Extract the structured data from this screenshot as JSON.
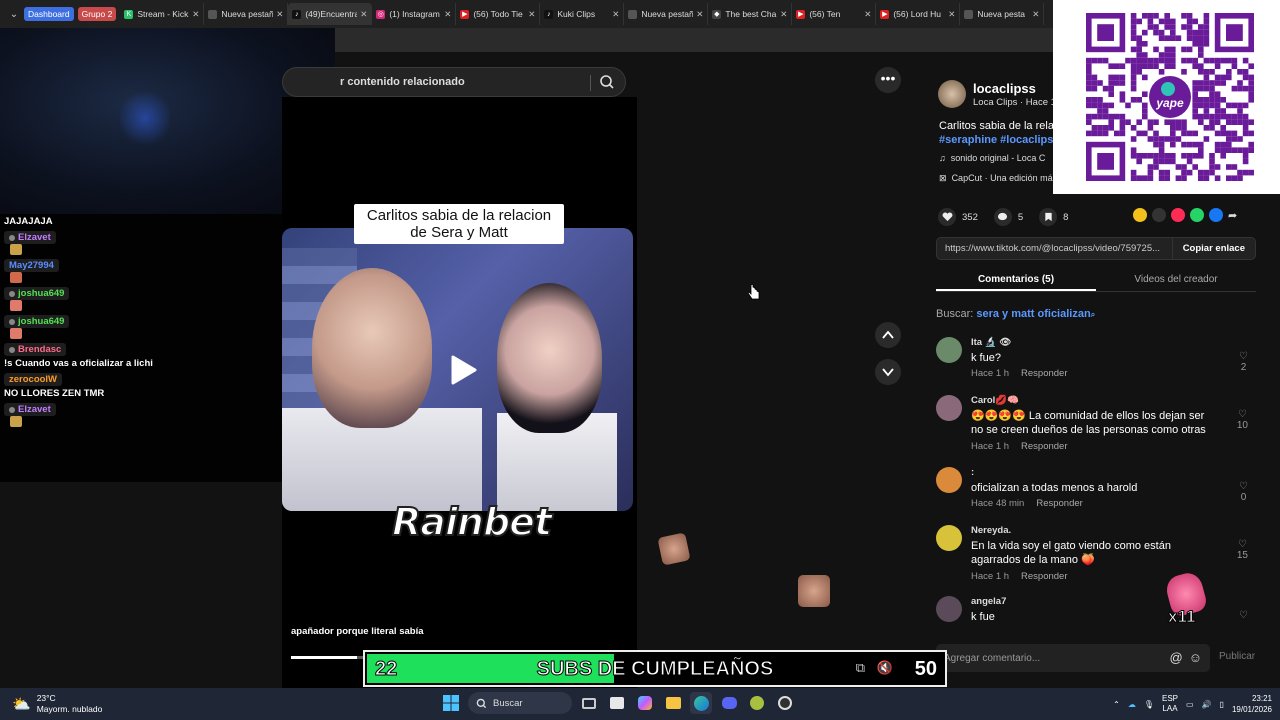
{
  "browser": {
    "groups": [
      {
        "label": "Dashboard",
        "color": "#3d6fe0"
      },
      {
        "label": "Grupo 2",
        "color": "#c84a4a"
      }
    ],
    "tabs": [
      {
        "label": "Stream - Kick",
        "icon_color": "#29c36a",
        "icon": "kick-icon"
      },
      {
        "label": "Nueva pestaña",
        "icon_color": "#555555",
        "icon": "blank-page-icon"
      },
      {
        "label": "(49)Encuentra",
        "icon_color": "#111111",
        "icon": "tiktok-icon",
        "active": true
      },
      {
        "label": "(1) Instagram",
        "icon_color": "#d6287a",
        "icon": "instagram-icon"
      },
      {
        "label": "(56) Todo Tie",
        "icon_color": "#e02020",
        "icon": "youtube-icon"
      },
      {
        "label": "Kuki Clips",
        "icon_color": "#111111",
        "icon": "tiktok-icon"
      },
      {
        "label": "Nueva pestaña",
        "icon_color": "#555555",
        "icon": "blank-page-icon"
      },
      {
        "label": "The best Cha",
        "icon_color": "#444444",
        "icon": "web-icon"
      },
      {
        "label": "(56) Ten",
        "icon_color": "#e02020",
        "icon": "youtube-icon"
      },
      {
        "label": "(56) Lord Hu",
        "icon_color": "#e02020",
        "icon": "youtube-icon"
      },
      {
        "label": "Nueva pesta",
        "icon_color": "#555555",
        "icon": "blank-page-icon"
      }
    ]
  },
  "chat": {
    "lines": [
      {
        "type": "text",
        "text": "JAJAJAJA"
      },
      {
        "type": "user",
        "name": "Elzavet",
        "color": "#c37dff",
        "emote": "#c9a24a"
      },
      {
        "type": "user",
        "name": "May27994",
        "color": "#5b8cff",
        "emote": "#d06a4a"
      },
      {
        "type": "user",
        "name": "joshua649",
        "color": "#52e052",
        "emote": "#e07a6a"
      },
      {
        "type": "user",
        "name": "joshua649",
        "color": "#52e052",
        "emote": "#e07a6a"
      },
      {
        "type": "user",
        "name": "Brendasc",
        "color": "#ff6a8a",
        "msg": "!s Cuando vas a oficializar a lichi"
      },
      {
        "type": "user",
        "name": "zerocoolW",
        "color": "#ff9a2a",
        "msg": "NO LLORES ZEN TMR"
      },
      {
        "type": "user",
        "name": "Elzavet",
        "color": "#c37dff",
        "emote": "#c9a24a"
      }
    ]
  },
  "tiktok": {
    "search_text": "r contenido relacionado",
    "caption_line1": "Carlitos sabia de la relacion",
    "caption_line2": "de Sera y Matt",
    "watermark": "Rainbet",
    "video_description": "apañador porque literal sabía",
    "progress": 0.2,
    "author": {
      "username": "locaclipss",
      "subtitle": "Loca Clips · Hace 1",
      "desc": "Carlitos sabia de la rela",
      "tags": "#seraphine #locaclipss",
      "sound": "sonido original - Loca C",
      "capcut": "CapCut · Una edición má"
    },
    "stats": {
      "likes": "352",
      "comments": "5",
      "saves": "8"
    },
    "share_colors": [
      "#f2c21b",
      "#333333",
      "#fe2c55",
      "#25d366",
      "#1877f2"
    ],
    "link": {
      "url": "https://www.tiktok.com/@locaclipss/video/759725...",
      "copy_label": "Copiar enlace"
    },
    "tab_comments": "Comentarios (5)",
    "tab_creator": "Videos del creador",
    "search_prefix": "Buscar:",
    "search_query": "sera y matt oficializan",
    "comments": [
      {
        "user": "Ita 🔬 👁",
        "text": "k fue?",
        "time": "Hace 1 h",
        "likes": "2",
        "avatar": "#6a8a6a"
      },
      {
        "user": "Carol💋🧠",
        "text": "😍😍😍😍 La comunidad de ellos los dejan ser no se creen dueños de las personas como otras",
        "time": "Hace 1 h",
        "likes": "10",
        "avatar": "#8a6a7a"
      },
      {
        "user": ":",
        "text": "oficializan a todas menos a harold",
        "time": "Hace 48 min",
        "likes": "0",
        "avatar": "#d98a3a"
      },
      {
        "user": "Nereyda.",
        "text": "En la vida soy el gato viendo como están agarrados de la mano 🍑",
        "time": "Hace 1 h",
        "likes": "15",
        "avatar": "#d8c23a"
      },
      {
        "user": "angela7",
        "text": "k fue",
        "time": "",
        "likes": "",
        "avatar": "#5a4a5a"
      }
    ],
    "reply_label": "Responder",
    "comment_placeholder": "Agregar comentario...",
    "publish_label": "Publicar",
    "reaction_badge": "x11"
  },
  "overlay": {
    "subs_current": "22",
    "subs_title": "SUBS DE CUMPLEAÑOS",
    "subs_goal": "50",
    "subs_progress": 0.44,
    "qr_brand": "yape",
    "qr_color": "#6a1b9a"
  },
  "taskbar": {
    "temp": "23°C",
    "weather": "Mayorm. nublado",
    "search": "Buscar",
    "lang1": "ESP",
    "lang2": "LAA",
    "time": "23:21",
    "date": "19/01/2026"
  }
}
